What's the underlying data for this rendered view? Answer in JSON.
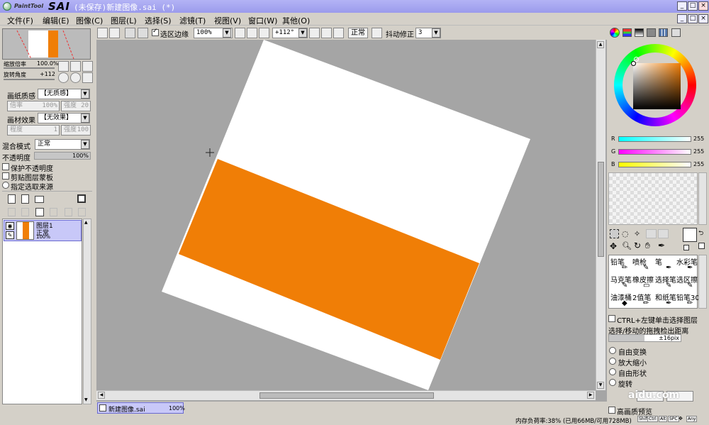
{
  "app": {
    "logo_small": "PaintTool",
    "logo_big": "SAI",
    "window_title": "(未保存)新建图像.sai (*)"
  },
  "menu": [
    "文件(F)",
    "编辑(E)",
    "图像(C)",
    "图层(L)",
    "选择(S)",
    "滤镜(T)",
    "视图(V)",
    "窗口(W)",
    "其他(O)"
  ],
  "toolbar": {
    "selection_edge": "选区边缘",
    "zoom": "100%",
    "rotation": "+112°",
    "mode": "正常",
    "stabilizer_label": "抖动修正",
    "stabilizer_value": "3"
  },
  "navigator": {
    "zoom_label": "缩放倍率",
    "zoom_value": "100.0%",
    "angle_label": "旋转角度",
    "angle_value": "+112"
  },
  "layer_props": {
    "paper_label": "画纸质感",
    "paper_value": "【无质感】",
    "paper_rate_label": "倍率",
    "paper_rate_value": "100%",
    "paper_strength_label": "强度",
    "paper_strength_value": "20",
    "effect_label": "画材效果",
    "effect_value": "【无效果】",
    "effect_degree_label": "程度",
    "effect_degree_value": "1",
    "effect_strength_label": "强度",
    "effect_strength_value": "100",
    "blend_label": "混合模式",
    "blend_value": "正常",
    "opacity_label": "不透明度",
    "opacity_value": "100%",
    "protect_opacity": "保护不透明度",
    "clip_group": "剪贴图层蒙板",
    "selection_source": "指定选取来源"
  },
  "layer": {
    "name": "图层1",
    "mode": "正常",
    "opacity": "100%"
  },
  "doc_tab": {
    "name": "新建图像.sai",
    "zoom": "100%"
  },
  "color": {
    "r_label": "R",
    "g_label": "G",
    "b_label": "B",
    "r": "255",
    "g": "255",
    "b": "255",
    "current": "#ffffff"
  },
  "tools": [
    [
      "铅笔",
      "喷枪",
      "笔",
      "水彩笔"
    ],
    [
      "马克笔",
      "橡皮擦",
      "选择笔",
      "选区擦"
    ],
    [
      "油漆桶",
      "2值笔",
      "和纸笔",
      "铅笔30"
    ]
  ],
  "options": {
    "ctrl_left": "CTRL+左键单击选择图层",
    "drag_label": "选择/移动的拖拽检出距离",
    "drag_value": "±16pix",
    "free_transform": "自由变换",
    "scale": "放大缩小",
    "deform": "自由形状",
    "rotate": "旋转",
    "hq_preview": "高画质预览"
  },
  "status": {
    "memory": "内存负荷率:38% (已用66MB/可用728MB)",
    "keys": [
      "Shift",
      "Ctrl",
      "Alt",
      "SPC",
      "Any"
    ]
  },
  "watermark": "aidu.com",
  "colors": {
    "orange": "#f07e06",
    "canvas_bg": "#a5a5a5",
    "title": "#9b9bec",
    "layer_sel": "#c8c8f8"
  }
}
